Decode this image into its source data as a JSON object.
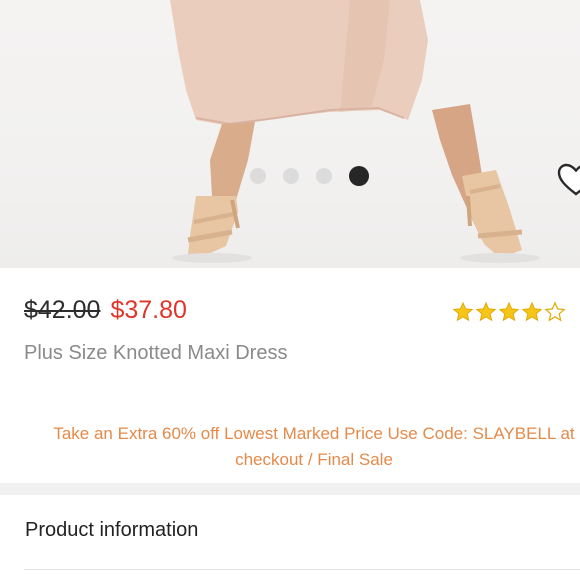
{
  "product": {
    "original_price": "$42.00",
    "sale_price": "$37.80",
    "title": "Plus Size Knotted Maxi Dress",
    "rating": 4,
    "rating_max": 5
  },
  "promo": {
    "line1": "Take an Extra 60% off Lowest Marked Price Use Code: SLAYBELL at",
    "line2": "checkout / Final Sale"
  },
  "carousel": {
    "image_count": 4,
    "active_index": 3
  },
  "sections": {
    "product_information": "Product information"
  },
  "colors": {
    "sale_price": "#e0352b",
    "promo_text": "#e48a4a",
    "star": "#f5c518"
  },
  "icons": {
    "favorite": "heart-outline-icon",
    "rating": "star-icon"
  }
}
